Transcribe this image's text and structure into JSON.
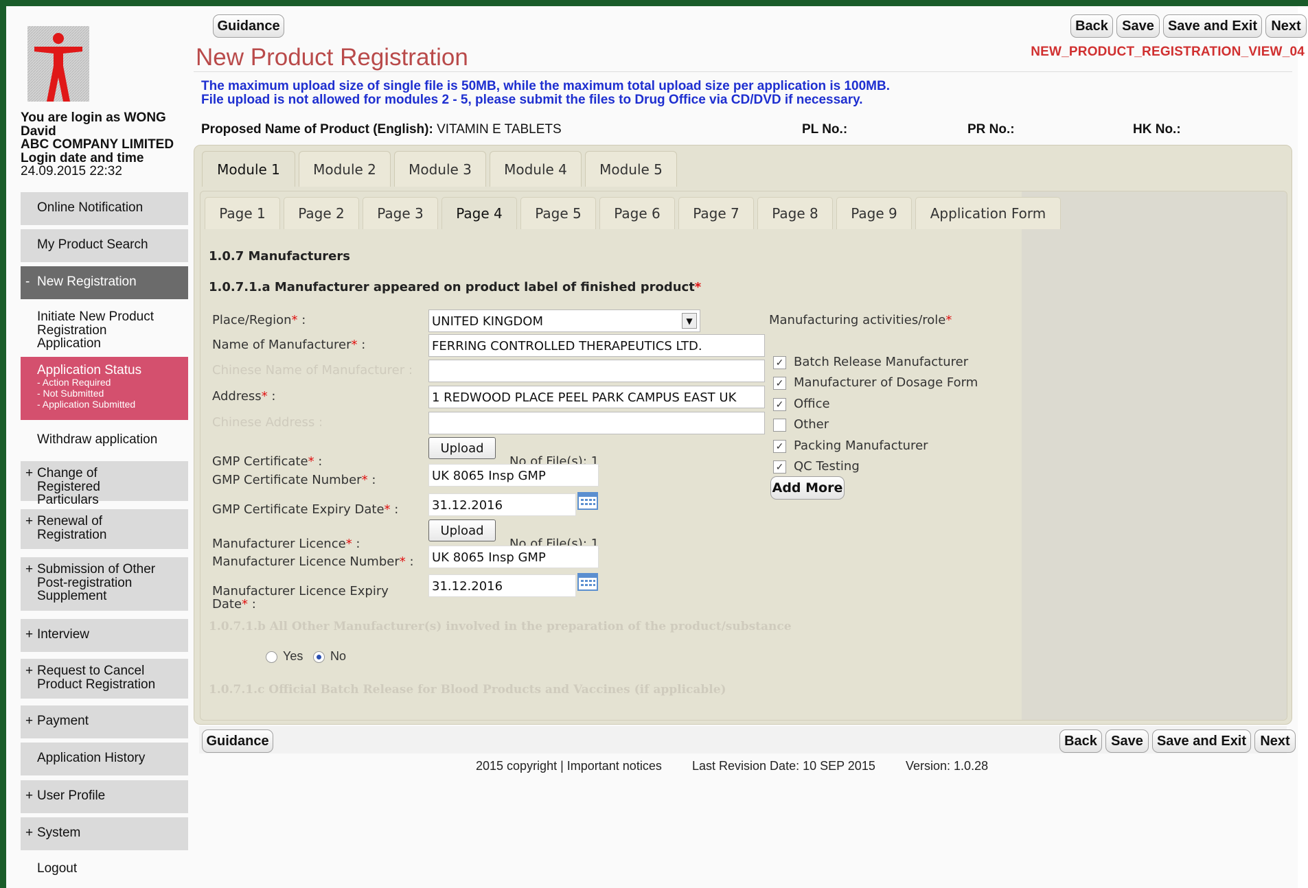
{
  "sidebar": {
    "login_text": "You are login as WONG David",
    "company": "ABC COMPANY LIMITED",
    "login_dt_label": "Login date and time",
    "login_dt": "24.09.2015 22:32",
    "items": [
      {
        "label": "Online Notification",
        "prefix": ""
      },
      {
        "label": "My Product Search",
        "prefix": ""
      },
      {
        "label": "New Registration",
        "prefix": "-"
      },
      {
        "label": "Initiate New Product Registration Application",
        "prefix": ""
      },
      {
        "label": "Application Status",
        "prefix": "",
        "subs": [
          "- Action Required",
          "- Not Submitted",
          "- Application Submitted"
        ]
      },
      {
        "label": "Withdraw application",
        "prefix": ""
      },
      {
        "label": "Change of Registered Particulars",
        "prefix": "+"
      },
      {
        "label": "Renewal of Registration",
        "prefix": "+"
      },
      {
        "label": "Submission of Other Post-registration Supplement",
        "prefix": "+"
      },
      {
        "label": "Interview",
        "prefix": "+"
      },
      {
        "label": "Request to Cancel Product Registration",
        "prefix": "+"
      },
      {
        "label": "Payment",
        "prefix": "+"
      },
      {
        "label": "Application History",
        "prefix": ""
      },
      {
        "label": "User Profile",
        "prefix": "+"
      },
      {
        "label": "System",
        "prefix": "+"
      },
      {
        "label": "Logout",
        "prefix": ""
      }
    ]
  },
  "toolbar": {
    "guidance": "Guidance",
    "back": "Back",
    "save": "Save",
    "save_exit": "Save and Exit",
    "next": "Next"
  },
  "header": {
    "title": "New Product Registration",
    "view_id": "NEW_PRODUCT_REGISTRATION_VIEW_04",
    "notice1": "The maximum upload size of single file is 50MB, while the maximum total upload size per application is 100MB.",
    "notice2": "File upload is not allowed for modules 2 - 5, please submit the files to Drug Office via CD/DVD if necessary."
  },
  "product": {
    "name_label": "Proposed Name of Product (English):",
    "name_value": "VITAMIN E TABLETS",
    "pl_label": "PL No.:",
    "pr_label": "PR No.:",
    "hk_label": "HK No.:"
  },
  "module_tabs": [
    "Module 1",
    "Module 2",
    "Module 3",
    "Module 4",
    "Module 5"
  ],
  "page_tabs": [
    "Page 1",
    "Page 2",
    "Page 3",
    "Page 4",
    "Page 5",
    "Page 6",
    "Page 7",
    "Page 8",
    "Page 9",
    "Application Form"
  ],
  "form": {
    "section": "1.0.7 Manufacturers",
    "subsection_a": "1.0.7.1.a Manufacturer appeared on product label of finished product",
    "place_label": "Place/Region",
    "place_value": "UNITED KINGDOM",
    "name_label": "Name of Manufacturer",
    "name_value": "FERRING CONTROLLED THERAPEUTICS LTD.",
    "chinese_name_label": "Chinese Name of Manufacturer :",
    "chinese_name_value": "",
    "address_label": "Address",
    "address_value": "1 REDWOOD PLACE PEEL PARK CAMPUS EAST UK",
    "chinese_address_label": "Chinese Address :",
    "chinese_address_value": "",
    "gmp_cert_label": "GMP Certificate",
    "upload_label": "Upload",
    "no_of_files": "No of File(s): 1",
    "gmp_number_label": "GMP Certificate Number",
    "gmp_number_value": "UK 8065 Insp GMP",
    "gmp_expiry_label": "GMP Certificate Expiry Date",
    "gmp_expiry_value": "31.12.2016",
    "lic_label": "Manufacturer Licence",
    "lic_number_label": "Manufacturer Licence Number",
    "lic_number_value": "UK 8065 Insp GMP",
    "lic_expiry_label_1": "Manufacturer Licence Expiry",
    "lic_expiry_label_2": "Date",
    "lic_expiry_value": "31.12.2016",
    "activities_label": "Manufacturing activities/role",
    "activities": [
      {
        "label": "Batch Release Manufacturer",
        "checked": true
      },
      {
        "label": "Manufacturer of Dosage Form",
        "checked": true
      },
      {
        "label": "Office",
        "checked": true
      },
      {
        "label": "Other",
        "checked": false
      },
      {
        "label": "Packing Manufacturer",
        "checked": true
      },
      {
        "label": "QC Testing",
        "checked": true
      }
    ],
    "add_more": "Add More",
    "subsection_b": "1.0.7.1.b All Other Manufacturer(s) involved in the preparation of the product/substance",
    "yes_label": "Yes",
    "no_label": "No",
    "selected": "No",
    "subsection_c": "1.0.7.1.c Official Batch Release for Blood Products and Vaccines (if applicable)"
  },
  "footer": {
    "copyright": "2015 copyright | Important notices",
    "revision": "Last Revision Date: 10 SEP 2015",
    "version": "Version: 1.0.28"
  },
  "colors": {
    "frame": "#1a5c2a",
    "active_menu": "#6b6b6b",
    "status_menu": "#d4506e",
    "title": "#b94a4a",
    "notice": "#1e2fd0"
  }
}
